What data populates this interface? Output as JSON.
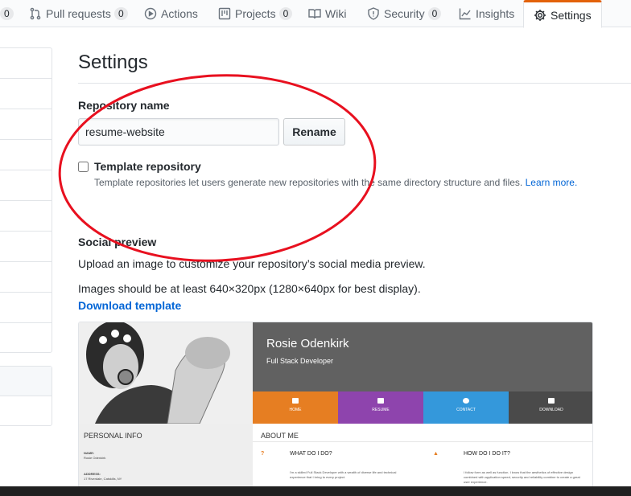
{
  "tabs": [
    {
      "label": "",
      "count": "0",
      "icon": "counter-fragment"
    },
    {
      "label": "Pull requests",
      "count": "0",
      "icon": "pull-request-icon"
    },
    {
      "label": "Actions",
      "count": "",
      "icon": "play-icon"
    },
    {
      "label": "Projects",
      "count": "0",
      "icon": "project-icon"
    },
    {
      "label": "Wiki",
      "count": "",
      "icon": "book-icon"
    },
    {
      "label": "Security",
      "count": "0",
      "icon": "shield-icon"
    },
    {
      "label": "Insights",
      "count": "",
      "icon": "graph-icon"
    },
    {
      "label": "Settings",
      "count": "",
      "icon": "gear-icon",
      "selected": true
    }
  ],
  "settings": {
    "title": "Settings",
    "repo_name_label": "Repository name",
    "repo_name_value": "resume-website",
    "rename_button": "Rename",
    "template_label": "Template repository",
    "template_checked": false,
    "template_note": "Template repositories let users generate new repositories with the same directory structure and files.",
    "learn_more": "Learn more."
  },
  "social_preview": {
    "title": "Social preview",
    "description": "Upload an image to customize your repository’s social media preview.",
    "size_note": "Images should be at least 640×320px (1280×640px for best display).",
    "download_link": "Download template",
    "image": {
      "name": "Rosie Odenkirk",
      "role": "Full Stack Developer",
      "nav": [
        "HOME",
        "RESUME",
        "CONTACT",
        "DOWNLOAD"
      ],
      "personal_info": "PERSONAL INFO",
      "name_label": "NAME:",
      "name_value": "Rosie Odenkirk",
      "address_label": "ADDRESS:",
      "address_value": "17 Riverdale, Catskills, NY",
      "about_me": "ABOUT ME",
      "what_title": "WHAT DO I DO?",
      "what_text": "I'm a skilled Full Stack Developer with a wealth of diverse life and technical experience that I bring to every project.",
      "how_title": "HOW DO I DO IT?",
      "how_text": "I follow form as well as function. I know that the aesthetics of effective design combined with application speed, security and reliability combine to create a great user experience."
    }
  },
  "colors": {
    "accent_orange": "#e36209",
    "link_blue": "#0366d6",
    "annotation_red": "#e8101f",
    "nav_home": "#e67e22",
    "nav_resume": "#8e44ad",
    "nav_contact": "#3498db",
    "nav_download": "#4a4a4a"
  }
}
